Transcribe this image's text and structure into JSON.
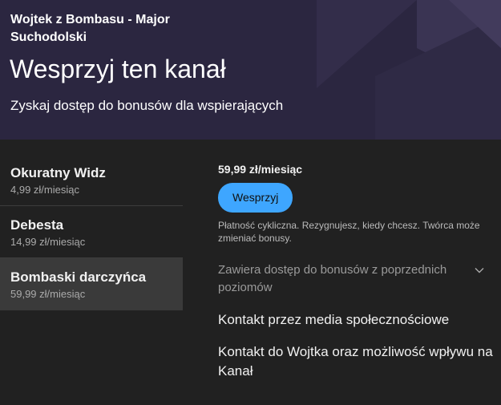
{
  "header": {
    "channel_name": "Wojtek z Bombasu - Major Suchodolski",
    "title": "Wesprzyj ten kanał",
    "subtitle": "Zyskaj dostęp do bonusów dla wspierających",
    "background_color": "#2b2640"
  },
  "tiers": [
    {
      "name": "Okuratny Widz",
      "price": "4,99 zł/miesiąc",
      "selected": false
    },
    {
      "name": "Debesta",
      "price": "14,99 zł/miesiąc",
      "selected": false
    },
    {
      "name": "Bombaski darczyńca",
      "price": "59,99 zł/miesiąc",
      "selected": true
    }
  ],
  "detail": {
    "price": "59,99 zł/miesiąc",
    "join_label": "Wesprzyj",
    "payment_note": "Płatność cykliczna. Rezygnujesz, kiedy chcesz. Twórca może zmieniać bonusy.",
    "includes_label": "Zawiera dostęp do bonusów z poprzednich poziomów",
    "perks": [
      "Kontakt przez media społecznościowe",
      "Kontakt do Wojtka oraz możliwość wpływu na Kanał"
    ]
  },
  "icons": {
    "expand": "chevron-down-icon"
  },
  "colors": {
    "accent": "#3ea6ff",
    "background": "#212121",
    "selected_tier": "#3a3a3a"
  }
}
